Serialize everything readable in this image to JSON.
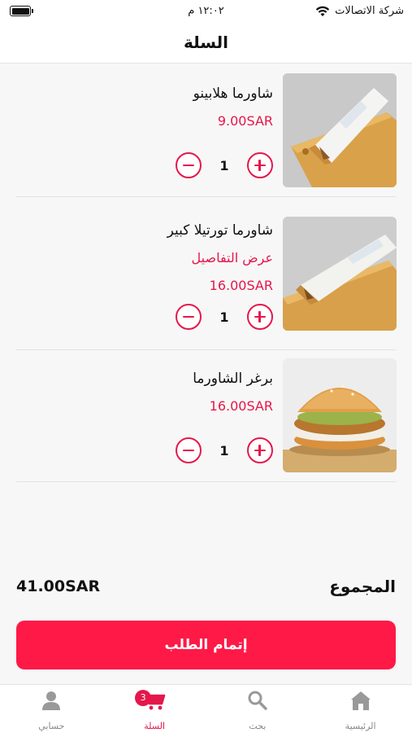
{
  "status_bar": {
    "carrier": "شركة الاتصالات",
    "time": "١٢:٠٢ م"
  },
  "header": {
    "title": "السلة"
  },
  "cart": {
    "items": [
      {
        "name": "شاورما هلابينو",
        "details": "",
        "price": "9.00SAR",
        "quantity": "1"
      },
      {
        "name": "شاورما تورتيلا كبير",
        "details": "عرض التفاصيل",
        "price": "16.00SAR",
        "quantity": "1"
      },
      {
        "name": "برغر الشاورما",
        "details": "",
        "price": "16.00SAR",
        "quantity": "1"
      }
    ]
  },
  "summary": {
    "total_label": "المجموع",
    "total_amount": "41.00SAR"
  },
  "checkout": {
    "label": "إتمام الطلب"
  },
  "tabbar": {
    "items": [
      {
        "label": "الرئيسية",
        "icon": "home-icon"
      },
      {
        "label": "بحث",
        "icon": "search-icon"
      },
      {
        "label": "السلة",
        "icon": "cart-icon",
        "badge": "3"
      },
      {
        "label": "حسابي",
        "icon": "user-icon"
      }
    ]
  },
  "colors": {
    "accent": "#e5174b",
    "button": "#ff1947"
  }
}
